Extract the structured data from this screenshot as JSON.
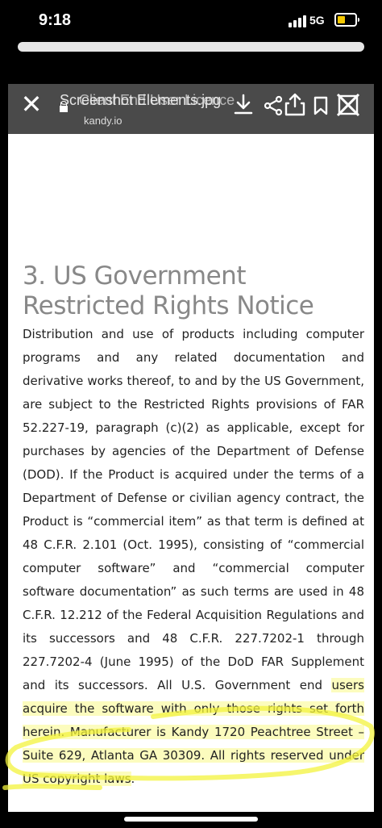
{
  "status_bar": {
    "time": "9:18",
    "network": "5G",
    "battery_color": "#f5c800"
  },
  "toolbar": {
    "title_line_a": "Screenshot Elements.jpg",
    "title_line_b": "Client End User Licence",
    "subdomain": "kandy.io",
    "icons": [
      "close-icon",
      "lock-icon",
      "download-icon",
      "share-icon",
      "upload-icon",
      "bookmark-icon",
      "crossed-out-icon"
    ]
  },
  "document": {
    "heading": "3. US Government Restricted Rights Notice",
    "paragraph_part1": "Distribution and use of products including computer programs and any related documentation and derivative works thereof, to and by the US Government, are subject to the Restricted Rights provisions of FAR 52.227-19, paragraph (c)(2) as applicable, except for purchases by agencies of the Department of Defense (DOD). If the Product is acquired under the terms of a Department of Defense or civilian agency contract, the Product is “commercial item” as that term is defined at 48 C.F.R. 2.101 (Oct. 1995), consisting of “commercial computer software” and “commercial computer software documentation” as such terms are used in 48 C.F.R. 12.212 of the Federal Acquisition Regulations and its successors and 48 C.F.R. 227.7202-1 through 227.7202-4 (June 1995) of the DoD FAR Supplement and its successors. All U.S. Government end ",
    "paragraph_highlight": "users acquire the software with only those rights set forth herein. Manufacturer is Kandy 1720 Peachtree Street – Suite 629, Atlanta GA 30309. All rights reserved under US copyright laws",
    "paragraph_end": "."
  },
  "annotation": {
    "highlighter_color": "#f3f33c"
  }
}
